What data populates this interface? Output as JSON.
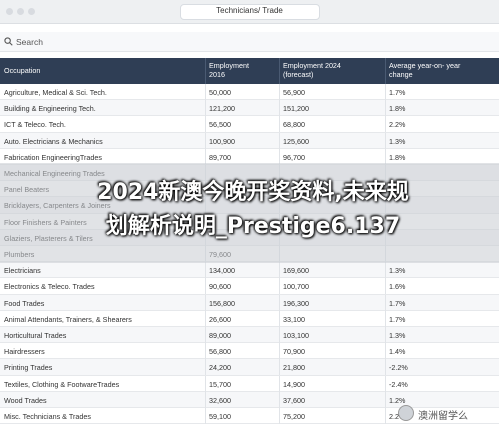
{
  "window": {
    "title": "Technicians/ Trade"
  },
  "search": {
    "label": "Search"
  },
  "table": {
    "headers": {
      "occupation": "Occupation",
      "emp2016": "Employment\n2016",
      "emp2024": "Employment 2024\n(forecast)",
      "growth": "Average year-on- year\nchange"
    },
    "rows": [
      {
        "occupation": "Agriculture, Medical & Sci. Tech.",
        "emp2016": "50,000",
        "emp2024": "56,900",
        "growth": "1.7%"
      },
      {
        "occupation": "Building & Engineering Tech.",
        "emp2016": "121,200",
        "emp2024": "151,200",
        "growth": "1.8%"
      },
      {
        "occupation": "ICT & Teleco. Tech.",
        "emp2016": "56,500",
        "emp2024": "68,800",
        "growth": "2.2%"
      },
      {
        "occupation": "Auto. Electricians & Mechanics",
        "emp2016": "100,900",
        "emp2024": "125,600",
        "growth": "1.3%"
      },
      {
        "occupation": "Fabrication EngineeringTrades",
        "emp2016": "89,700",
        "emp2024": "96,700",
        "growth": "1.8%"
      },
      {
        "occupation": "Mechanical Engineering Trades",
        "emp2016": "",
        "emp2024": "",
        "growth": ""
      },
      {
        "occupation": "Panel Beaters",
        "emp2016": "",
        "emp2024": "",
        "growth": ""
      },
      {
        "occupation": "Bricklayers, Carpenters & Joiners",
        "emp2016": "",
        "emp2024": "",
        "growth": ""
      },
      {
        "occupation": "Floor Finishers & Painters",
        "emp2016": "",
        "emp2024": "",
        "growth": ""
      },
      {
        "occupation": "Glaziers, Plasterers & Tilers",
        "emp2016": "",
        "emp2024": "",
        "growth": ""
      },
      {
        "occupation": "Plumbers",
        "emp2016": "79,600",
        "emp2024": "",
        "growth": ""
      },
      {
        "occupation": "Electricians",
        "emp2016": "134,000",
        "emp2024": "169,600",
        "growth": "1.3%"
      },
      {
        "occupation": "Electronics & Teleco. Trades",
        "emp2016": "90,600",
        "emp2024": "100,700",
        "growth": "1.6%"
      },
      {
        "occupation": "Food Trades",
        "emp2016": "156,800",
        "emp2024": "196,300",
        "growth": "1.7%"
      },
      {
        "occupation": "Animal Attendants, Trainers, & Shearers",
        "emp2016": "26,600",
        "emp2024": "33,100",
        "growth": "1.7%"
      },
      {
        "occupation": "Horticultural Trades",
        "emp2016": "89,000",
        "emp2024": "103,100",
        "growth": "1.3%"
      },
      {
        "occupation": "Hairdressers",
        "emp2016": "56,800",
        "emp2024": "70,900",
        "growth": "1.4%"
      },
      {
        "occupation": "Printing Trades",
        "emp2016": "24,200",
        "emp2024": "21,800",
        "growth": "-2.2%"
      },
      {
        "occupation": "Textiles, Clothing & FootwareTrades",
        "emp2016": "15,700",
        "emp2024": "14,900",
        "growth": "-2.4%"
      },
      {
        "occupation": "Wood Trades",
        "emp2016": "32,600",
        "emp2024": "37,600",
        "growth": "1.2%"
      },
      {
        "occupation": "Misc. Technicians & Trades",
        "emp2016": "59,100",
        "emp2024": "75,200",
        "growth": "2.2%"
      }
    ]
  },
  "overlay": {
    "line1": "2024新澳今晚开奖资料,未来规",
    "line2": "划解析说明_Prestige6.137"
  },
  "watermark": {
    "text": "澳洲留学么"
  },
  "colors": {
    "header_bg": "#2f3e55",
    "text": "#333333"
  }
}
